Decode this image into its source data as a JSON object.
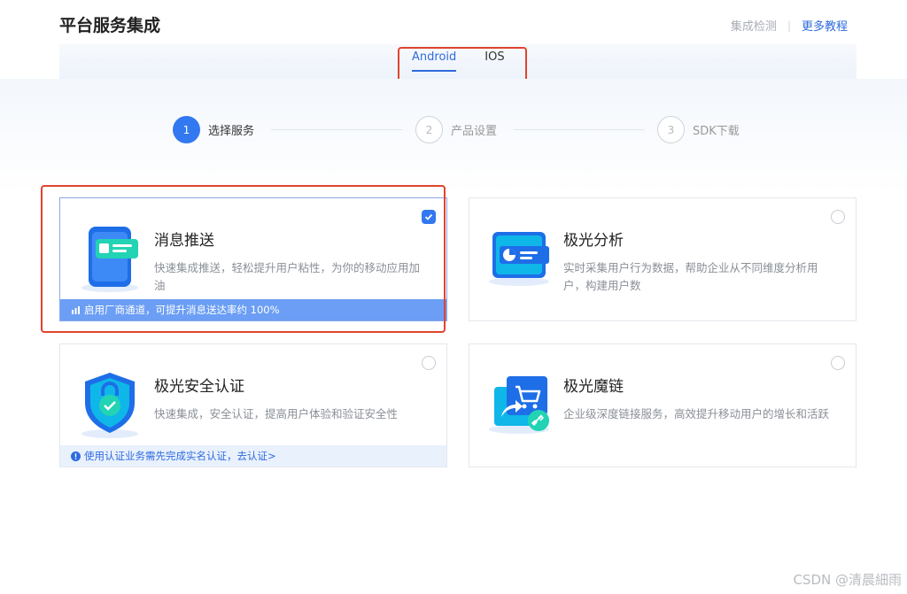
{
  "header": {
    "title": "平台服务集成",
    "link_check": "集成检测",
    "link_separator": "|",
    "link_more": "更多教程"
  },
  "tabs": [
    {
      "label": "Android",
      "active": true
    },
    {
      "label": "IOS",
      "active": false
    }
  ],
  "steps": [
    {
      "number": "1",
      "label": "选择服务",
      "active": true
    },
    {
      "number": "2",
      "label": "产品设置",
      "active": false
    },
    {
      "number": "3",
      "label": "SDK下载",
      "active": false
    }
  ],
  "cards": {
    "push": {
      "title": "消息推送",
      "desc": "快速集成推送，轻松提升用户粘性，为你的移动应用加油",
      "footer": "启用厂商通道，可提升消息送达率约 100%",
      "checked": true,
      "icon": "phone-message-icon"
    },
    "analysis": {
      "title": "极光分析",
      "desc": "实时采集用户行为数据，帮助企业从不同维度分析用户，构建用户数",
      "checked": false,
      "icon": "analytics-chart-icon"
    },
    "security": {
      "title": "极光安全认证",
      "desc": "快速集成，安全认证，提高用户体验和验证安全性",
      "footer": "使用认证业务需先完成实名认证，去认证>",
      "checked": false,
      "icon": "shield-lock-icon"
    },
    "link": {
      "title": "极光魔链",
      "desc": "企业级深度链接服务，高效提升移动用户的增长和活跃",
      "checked": false,
      "icon": "cart-link-icon"
    }
  },
  "watermark": "CSDN @清晨細雨",
  "colors": {
    "primary": "#3278f0",
    "annotation_red": "#e0442e"
  }
}
